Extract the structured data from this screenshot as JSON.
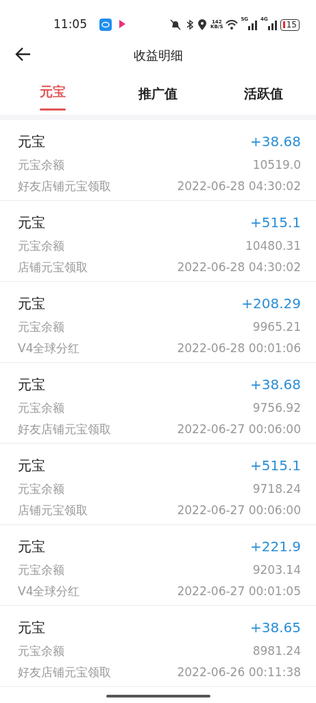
{
  "status_bar": {
    "time": "11:05",
    "speed": "142",
    "speed_unit": "KB/S",
    "network_1": "5G",
    "network_2": "4G",
    "battery": "15"
  },
  "header": {
    "title": "收益明细"
  },
  "tabs": [
    {
      "label": "元宝",
      "selected": true
    },
    {
      "label": "推广值",
      "selected": false
    },
    {
      "label": "活跃值",
      "selected": false
    }
  ],
  "records": [
    {
      "title": "元宝",
      "amount": "+38.68",
      "balance_label": "元宝余额",
      "balance": "10519.0",
      "source": "好友店铺元宝领取",
      "time": "2022-06-28 04:30:02"
    },
    {
      "title": "元宝",
      "amount": "+515.1",
      "balance_label": "元宝余额",
      "balance": "10480.31",
      "source": "店铺元宝领取",
      "time": "2022-06-28 04:30:02"
    },
    {
      "title": "元宝",
      "amount": "+208.29",
      "balance_label": "元宝余额",
      "balance": "9965.21",
      "source": "V4全球分红",
      "time": "2022-06-28 00:01:06"
    },
    {
      "title": "元宝",
      "amount": "+38.68",
      "balance_label": "元宝余额",
      "balance": "9756.92",
      "source": "好友店铺元宝领取",
      "time": "2022-06-27 00:06:00"
    },
    {
      "title": "元宝",
      "amount": "+515.1",
      "balance_label": "元宝余额",
      "balance": "9718.24",
      "source": "店铺元宝领取",
      "time": "2022-06-27 00:06:00"
    },
    {
      "title": "元宝",
      "amount": "+221.9",
      "balance_label": "元宝余额",
      "balance": "9203.14",
      "source": "V4全球分红",
      "time": "2022-06-27 00:01:05"
    },
    {
      "title": "元宝",
      "amount": "+38.65",
      "balance_label": "元宝余额",
      "balance": "8981.24",
      "source": "好友店铺元宝领取",
      "time": "2022-06-26 00:11:38"
    }
  ]
}
